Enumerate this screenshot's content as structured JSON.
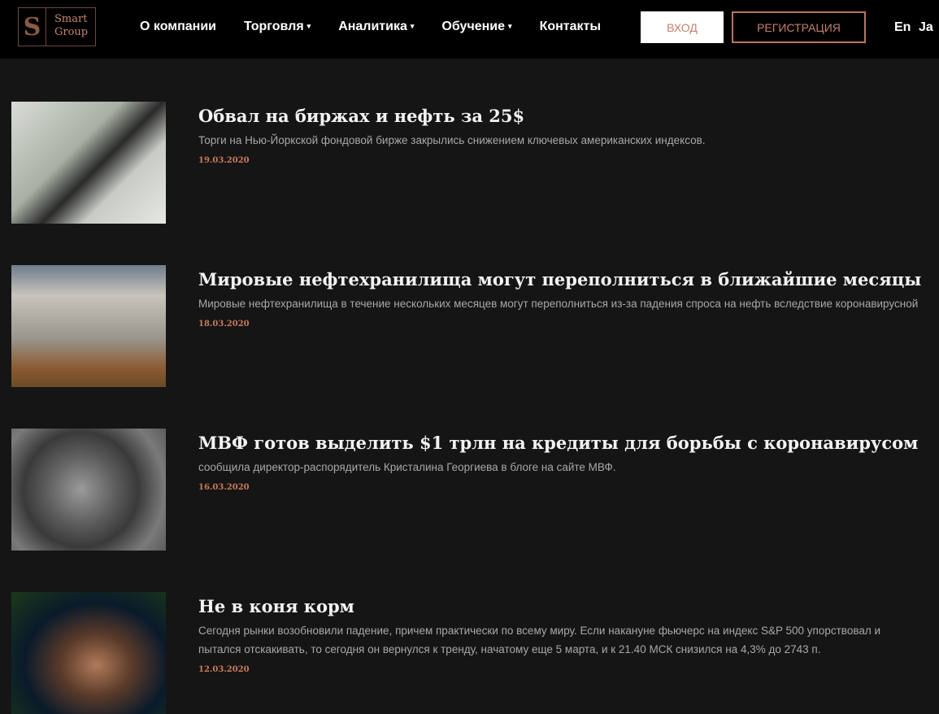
{
  "header": {
    "logo_text": [
      "Smart",
      "Group"
    ],
    "logo_mark": "S",
    "nav": [
      {
        "label": "О компании",
        "dropdown": false
      },
      {
        "label": "Торговля",
        "dropdown": true
      },
      {
        "label": "Аналитика",
        "dropdown": true
      },
      {
        "label": "Обучение",
        "dropdown": true
      },
      {
        "label": "Контакты",
        "dropdown": false
      }
    ],
    "caret": "▾",
    "login": "ВХОД",
    "register": "РЕГИСТРАЦИЯ",
    "langs": [
      "En",
      "Ja"
    ]
  },
  "news": [
    {
      "title": "Обвал на биржах и нефть за 25$",
      "desc": "Торги на Нью-Йоркской фондовой бирже закрылись снижением ключевых американских индексов.",
      "date": "19.03.2020"
    },
    {
      "title": "Мировые нефтехранилища могут переполниться в ближайшие месяцы",
      "desc": "Мировые нефтехранилища в течение нескольких месяцев могут переполниться из-за падения спроса на нефть вследствие коронавирусной",
      "date": "18.03.2020"
    },
    {
      "title": "МВФ готов выделить $1 трлн на кредиты для борьбы с коронавирусом",
      "desc": "сообщила директор-распорядитель Кристалина Георгиева в блоге на сайте МВФ.",
      "date": "16.03.2020"
    },
    {
      "title": "Не в коня корм",
      "desc": "Сегодня рынки возобновили падение, причем практически по всему миру. Если накануне фьючерс на индекс S&P 500 упорствовал и пытался отскакивать, то сегодня он вернулся к тренду, начатому еще 5 марта, и к 21.40 МСК снизился на 4,3% до 2743 п.",
      "date": "12.03.2020"
    }
  ]
}
